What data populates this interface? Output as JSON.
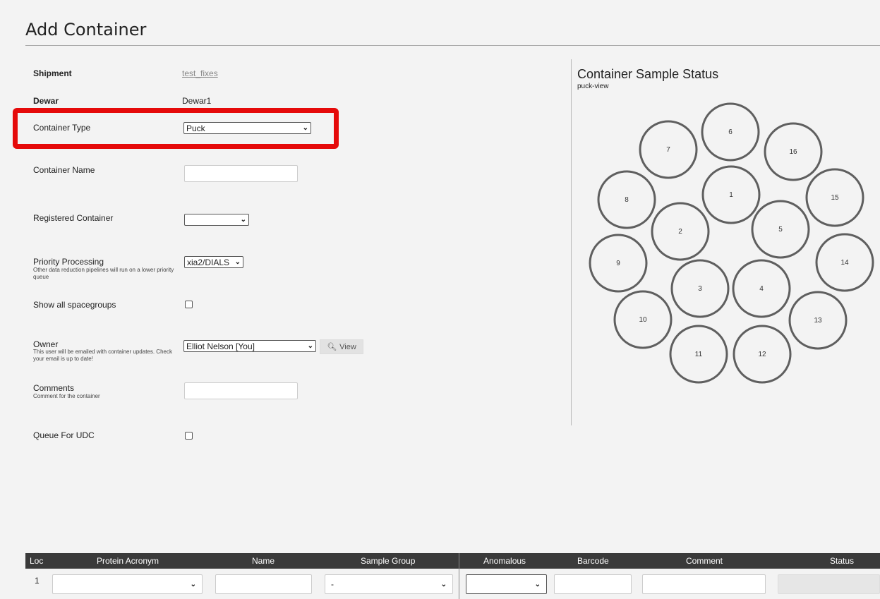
{
  "page": {
    "title": "Add Container"
  },
  "form": {
    "shipment": {
      "label": "Shipment",
      "value": "test_fixes"
    },
    "dewar": {
      "label": "Dewar",
      "value": "Dewar1"
    },
    "container_type": {
      "label": "Container Type",
      "value": "Puck"
    },
    "container_name": {
      "label": "Container Name",
      "value": ""
    },
    "registered_container": {
      "label": "Registered Container",
      "value": ""
    },
    "priority_processing": {
      "label": "Priority Processing",
      "sub": "Other data reduction pipelines will run on a lower priority queue",
      "value": "xia2/DIALS"
    },
    "show_spacegroups": {
      "label": "Show all spacegroups",
      "checked": false
    },
    "owner": {
      "label": "Owner",
      "sub": "This user will be emailed with container updates. Check your email is up to date!",
      "value": "Elliot Nelson [You]",
      "view_label": "View"
    },
    "comments": {
      "label": "Comments",
      "sub": "Comment for the container",
      "value": ""
    },
    "queue_udc": {
      "label": "Queue For UDC",
      "checked": false
    }
  },
  "status_panel": {
    "title": "Container Sample Status",
    "subtitle": "puck-view",
    "positions": [
      "1",
      "2",
      "3",
      "4",
      "5",
      "6",
      "7",
      "8",
      "9",
      "10",
      "11",
      "12",
      "13",
      "14",
      "15",
      "16"
    ]
  },
  "table": {
    "headers": [
      "Loc",
      "Protein Acronym",
      "Name",
      "Sample Group",
      "Anomalous",
      "Barcode",
      "Comment",
      "Status"
    ],
    "rows": [
      {
        "loc": "1",
        "protein": "",
        "name": "",
        "sample_group": "-",
        "anomalous": "",
        "barcode": "",
        "comment": "",
        "status": ""
      }
    ]
  },
  "colors": {
    "highlight": "#e50a0a",
    "table_header": "#3a3a3a",
    "background": "#f3f3f3"
  }
}
